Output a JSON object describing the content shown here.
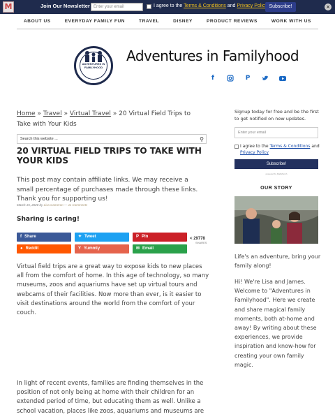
{
  "newsletter_bar": {
    "logo": "M",
    "title": "Join Our Newsletter",
    "email_placeholder": "Enter your email",
    "agree_prefix": "I agree to the",
    "terms_link": "Terms & Conditions",
    "and": "and",
    "privacy_link": "Privacy Policy",
    "subscribe": "Subscribe!",
    "close": "×"
  },
  "nav": [
    "ABOUT US",
    "EVERYDAY FAMILY FUN",
    "TRAVEL",
    "DISNEY",
    "PRODUCT REVIEWS",
    "WORK WITH US"
  ],
  "header": {
    "logo_text": "ADVENTURES IN FAMILYHOOD",
    "site_title": "Adventures in Familyhood",
    "social_icons": [
      "facebook-icon",
      "instagram-icon",
      "pinterest-icon",
      "twitter-icon",
      "youtube-icon"
    ]
  },
  "breadcrumb": {
    "home": "Home",
    "sep": "»",
    "travel": "Travel",
    "virtual_travel": "Virtual Travel",
    "current": "20 Virtual Field Trips to Take with Your Kids"
  },
  "search": {
    "placeholder": "Search this website ..."
  },
  "post": {
    "title": "20 VIRTUAL FIELD TRIPS TO TAKE WITH YOUR KIDS",
    "disclosure": "This post may contain affiliate links. We may receive a small percentage of purchases made through these links. Thank you for supporting us!",
    "date": "March 15, 2020",
    "by": "by",
    "author": "Lisa Cameron",
    "dash": "—",
    "comments": "11 Comments",
    "sharing_heading": "Sharing is caring!",
    "para1": "Virtual field trips are a great way to expose kids to new places all from the comfort of home. In this age of technology, so many museums, zoos and aquariums have set up virtual tours and webcams of their facilities. Now more than ever, is it easier to visit destinations around the world from the comfort of your couch.",
    "para2": "In light of recent events, families are finding themselves in the position of not only being at home with their children for an extended period of time, but educating them as well. Unlike a school vacation, places like zoos, aquariums and museums are"
  },
  "share": {
    "facebook": "Share",
    "twitter": "Tweet",
    "pinterest": "Pin",
    "reddit": "Reddit",
    "yummly": "Yummly",
    "email": "Email",
    "count": "29778",
    "count_label": "SHARES"
  },
  "sidebar": {
    "intro": "Signup today for free and be the first to get notified on new updates.",
    "email_placeholder": "Enter your email",
    "agree_prefix": "I agree to the",
    "terms_link": "Terms & Conditions",
    "and": "and",
    "privacy_link": "Privacy Policy",
    "subscribe": "Subscribe!",
    "powered": "powered by MailMunch",
    "story_heading": "OUR STORY",
    "tagline": "Life's an adventure, bring your family along!",
    "bio": "Hi! We're Lisa and James. Welcome to \"Adventures in Familyhood\".  Here we create and share magical family moments, both at-home and away!  By writing about these experiences, we provide inspiration and know-how for creating your own family magic."
  },
  "colors": {
    "navy": "#1f2b4d",
    "facebook": "#3b5998",
    "twitter": "#1da1f2",
    "pinterest": "#cb2027",
    "reddit": "#ff5700",
    "yummly": "#e5634c",
    "email": "#2aa14a"
  }
}
